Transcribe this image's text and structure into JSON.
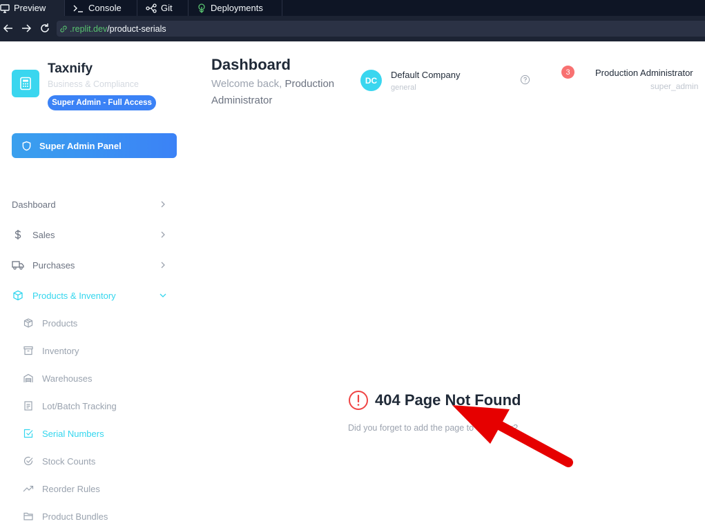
{
  "replit": {
    "tabs": [
      {
        "label": "Preview",
        "icon": "monitor-icon"
      },
      {
        "label": "Console",
        "icon": "terminal-icon"
      },
      {
        "label": "Git",
        "icon": "git-icon"
      },
      {
        "label": "Deployments",
        "icon": "deployments-icon"
      }
    ],
    "url_host": ".replit.dev",
    "url_path": "/product-serials"
  },
  "brand": {
    "name": "Taxnify",
    "subtitle": "Business & Compliance",
    "role_badge": "Super Admin - Full Access",
    "icon": "calculator-icon"
  },
  "sidebar": {
    "admin_panel_label": "Super Admin Panel",
    "items": [
      {
        "label": "Dashboard",
        "icon": ""
      },
      {
        "label": "Sales",
        "icon": "dollar-icon"
      },
      {
        "label": "Purchases",
        "icon": "truck-icon"
      },
      {
        "label": "Products & Inventory",
        "icon": "box-icon",
        "expanded": true
      }
    ],
    "sub_items": [
      {
        "label": "Products",
        "icon": "package-icon"
      },
      {
        "label": "Inventory",
        "icon": "archive-icon"
      },
      {
        "label": "Warehouses",
        "icon": "warehouse-icon"
      },
      {
        "label": "Lot/Batch Tracking",
        "icon": "file-text-icon"
      },
      {
        "label": "Serial Numbers",
        "icon": "check-square-icon",
        "active": true
      },
      {
        "label": "Stock Counts",
        "icon": "check-circle-icon"
      },
      {
        "label": "Reorder Rules",
        "icon": "trend-icon"
      },
      {
        "label": "Product Bundles",
        "icon": "folder-icon"
      }
    ]
  },
  "header": {
    "title": "Dashboard",
    "welcome_prefix": "Welcome back,",
    "welcome_name": "Production Administrator",
    "company_initials": "DC",
    "company_name": "Default Company",
    "company_type": "general",
    "notification_count": "3",
    "user_name": "Production Administrator",
    "user_role": "super_admin"
  },
  "not_found": {
    "title": "404 Page Not Found",
    "message": "Did you forget to add the page to the router?"
  },
  "colors": {
    "accent": "#34d6ee",
    "primary": "#3b82f6",
    "danger": "#ef4444",
    "annotation": "#e60000"
  }
}
